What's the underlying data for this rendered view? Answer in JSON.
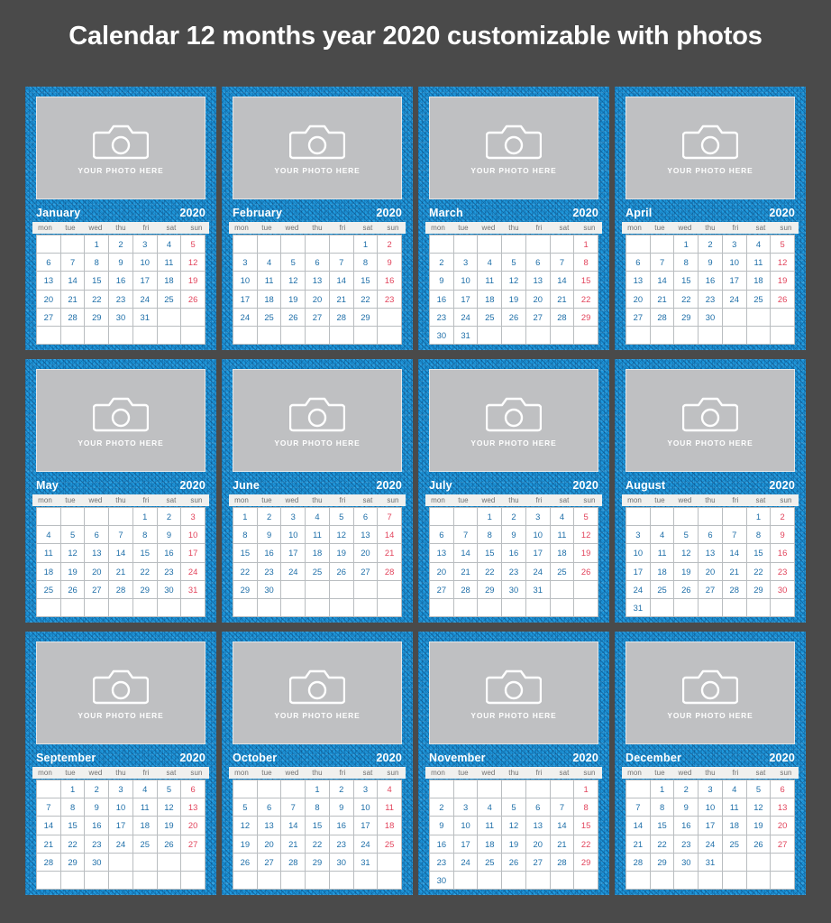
{
  "page": {
    "title": "Calendar 12 months year 2020 customizable with photos",
    "background_color": "#4a4a4a",
    "accent_color": "#1f9ade",
    "weekday_color": "#1d6ea8",
    "sunday_color": "#e2445c"
  },
  "photo_placeholder": {
    "label": "YOUR PHOTO HERE",
    "icon": "camera-icon",
    "background_color": "#bfc0c2"
  },
  "weekdays": [
    "mon",
    "tue",
    "wed",
    "thu",
    "fri",
    "sat",
    "sun"
  ],
  "year": "2020",
  "months": [
    {
      "name": "January",
      "year": "2020",
      "lead_blanks": 2,
      "days": 31,
      "rows": 6,
      "weeks": [
        [
          "",
          "",
          "1",
          "2",
          "3",
          "4",
          "5"
        ],
        [
          "6",
          "7",
          "8",
          "9",
          "10",
          "11",
          "12"
        ],
        [
          "13",
          "14",
          "15",
          "16",
          "17",
          "18",
          "19"
        ],
        [
          "20",
          "21",
          "22",
          "23",
          "24",
          "25",
          "26"
        ],
        [
          "27",
          "28",
          "29",
          "30",
          "31",
          "",
          ""
        ],
        [
          "",
          "",
          "",
          "",
          "",
          "",
          ""
        ]
      ]
    },
    {
      "name": "February",
      "year": "2020",
      "lead_blanks": 5,
      "days": 29,
      "rows": 6,
      "weeks": [
        [
          "",
          "",
          "",
          "",
          "",
          "1",
          "2"
        ],
        [
          "3",
          "4",
          "5",
          "6",
          "7",
          "8",
          "9"
        ],
        [
          "10",
          "11",
          "12",
          "13",
          "14",
          "15",
          "16"
        ],
        [
          "17",
          "18",
          "19",
          "20",
          "21",
          "22",
          "23"
        ],
        [
          "24",
          "25",
          "26",
          "27",
          "28",
          "29",
          ""
        ],
        [
          "",
          "",
          "",
          "",
          "",
          "",
          ""
        ]
      ]
    },
    {
      "name": "March",
      "year": "2020",
      "lead_blanks": 6,
      "days": 31,
      "rows": 6,
      "weeks": [
        [
          "",
          "",
          "",
          "",
          "",
          "",
          "1"
        ],
        [
          "2",
          "3",
          "4",
          "5",
          "6",
          "7",
          "8"
        ],
        [
          "9",
          "10",
          "11",
          "12",
          "13",
          "14",
          "15"
        ],
        [
          "16",
          "17",
          "18",
          "19",
          "20",
          "21",
          "22"
        ],
        [
          "23",
          "24",
          "25",
          "26",
          "27",
          "28",
          "29"
        ],
        [
          "30",
          "31",
          "",
          "",
          "",
          "",
          ""
        ]
      ]
    },
    {
      "name": "April",
      "year": "2020",
      "lead_blanks": 2,
      "days": 30,
      "rows": 6,
      "weeks": [
        [
          "",
          "",
          "1",
          "2",
          "3",
          "4",
          "5"
        ],
        [
          "6",
          "7",
          "8",
          "9",
          "10",
          "11",
          "12"
        ],
        [
          "13",
          "14",
          "15",
          "16",
          "17",
          "18",
          "19"
        ],
        [
          "20",
          "21",
          "22",
          "23",
          "24",
          "25",
          "26"
        ],
        [
          "27",
          "28",
          "29",
          "30",
          "",
          "",
          ""
        ],
        [
          "",
          "",
          "",
          "",
          "",
          "",
          ""
        ]
      ]
    },
    {
      "name": "May",
      "year": "2020",
      "lead_blanks": 4,
      "days": 31,
      "rows": 6,
      "weeks": [
        [
          "",
          "",
          "",
          "",
          "1",
          "2",
          "3"
        ],
        [
          "4",
          "5",
          "6",
          "7",
          "8",
          "9",
          "10"
        ],
        [
          "11",
          "12",
          "13",
          "14",
          "15",
          "16",
          "17"
        ],
        [
          "18",
          "19",
          "20",
          "21",
          "22",
          "23",
          "24"
        ],
        [
          "25",
          "26",
          "27",
          "28",
          "29",
          "30",
          "31"
        ],
        [
          "",
          "",
          "",
          "",
          "",
          "",
          ""
        ]
      ]
    },
    {
      "name": "June",
      "year": "2020",
      "lead_blanks": 0,
      "days": 30,
      "rows": 6,
      "weeks": [
        [
          "1",
          "2",
          "3",
          "4",
          "5",
          "6",
          "7"
        ],
        [
          "8",
          "9",
          "10",
          "11",
          "12",
          "13",
          "14"
        ],
        [
          "15",
          "16",
          "17",
          "18",
          "19",
          "20",
          "21"
        ],
        [
          "22",
          "23",
          "24",
          "25",
          "26",
          "27",
          "28"
        ],
        [
          "29",
          "30",
          "",
          "",
          "",
          "",
          ""
        ],
        [
          "",
          "",
          "",
          "",
          "",
          "",
          ""
        ]
      ]
    },
    {
      "name": "July",
      "year": "2020",
      "lead_blanks": 2,
      "days": 31,
      "rows": 6,
      "weeks": [
        [
          "",
          "",
          "1",
          "2",
          "3",
          "4",
          "5"
        ],
        [
          "6",
          "7",
          "8",
          "9",
          "10",
          "11",
          "12"
        ],
        [
          "13",
          "14",
          "15",
          "16",
          "17",
          "18",
          "19"
        ],
        [
          "20",
          "21",
          "22",
          "23",
          "24",
          "25",
          "26"
        ],
        [
          "27",
          "28",
          "29",
          "30",
          "31",
          "",
          ""
        ],
        [
          "",
          "",
          "",
          "",
          "",
          "",
          ""
        ]
      ]
    },
    {
      "name": "August",
      "year": "2020",
      "lead_blanks": 5,
      "days": 31,
      "rows": 6,
      "weeks": [
        [
          "",
          "",
          "",
          "",
          "",
          "1",
          "2"
        ],
        [
          "3",
          "4",
          "5",
          "6",
          "7",
          "8",
          "9"
        ],
        [
          "10",
          "11",
          "12",
          "13",
          "14",
          "15",
          "16"
        ],
        [
          "17",
          "18",
          "19",
          "20",
          "21",
          "22",
          "23"
        ],
        [
          "24",
          "25",
          "26",
          "27",
          "28",
          "29",
          "30"
        ],
        [
          "31",
          "",
          "",
          "",
          "",
          "",
          ""
        ]
      ]
    },
    {
      "name": "September",
      "year": "2020",
      "lead_blanks": 1,
      "days": 30,
      "rows": 6,
      "weeks": [
        [
          "",
          "1",
          "2",
          "3",
          "4",
          "5",
          "6"
        ],
        [
          "7",
          "8",
          "9",
          "10",
          "11",
          "12",
          "13"
        ],
        [
          "14",
          "15",
          "16",
          "17",
          "18",
          "19",
          "20"
        ],
        [
          "21",
          "22",
          "23",
          "24",
          "25",
          "26",
          "27"
        ],
        [
          "28",
          "29",
          "30",
          "",
          "",
          "",
          ""
        ],
        [
          "",
          "",
          "",
          "",
          "",
          "",
          ""
        ]
      ]
    },
    {
      "name": "October",
      "year": "2020",
      "lead_blanks": 3,
      "days": 31,
      "rows": 6,
      "weeks": [
        [
          "",
          "",
          "",
          "1",
          "2",
          "3",
          "4"
        ],
        [
          "5",
          "6",
          "7",
          "8",
          "9",
          "10",
          "11"
        ],
        [
          "12",
          "13",
          "14",
          "15",
          "16",
          "17",
          "18"
        ],
        [
          "19",
          "20",
          "21",
          "22",
          "23",
          "24",
          "25"
        ],
        [
          "26",
          "27",
          "28",
          "29",
          "30",
          "31",
          ""
        ],
        [
          "",
          "",
          "",
          "",
          "",
          "",
          ""
        ]
      ]
    },
    {
      "name": "November",
      "year": "2020",
      "lead_blanks": 6,
      "days": 30,
      "rows": 6,
      "weeks": [
        [
          "",
          "",
          "",
          "",
          "",
          "",
          "1"
        ],
        [
          "2",
          "3",
          "4",
          "5",
          "6",
          "7",
          "8"
        ],
        [
          "9",
          "10",
          "11",
          "12",
          "13",
          "14",
          "15"
        ],
        [
          "16",
          "17",
          "18",
          "19",
          "20",
          "21",
          "22"
        ],
        [
          "23",
          "24",
          "25",
          "26",
          "27",
          "28",
          "29"
        ],
        [
          "30",
          "",
          "",
          "",
          "",
          "",
          ""
        ]
      ]
    },
    {
      "name": "December",
      "year": "2020",
      "lead_blanks": 1,
      "days": 31,
      "rows": 6,
      "weeks": [
        [
          "",
          "1",
          "2",
          "3",
          "4",
          "5",
          "6"
        ],
        [
          "7",
          "8",
          "9",
          "10",
          "11",
          "12",
          "13"
        ],
        [
          "14",
          "15",
          "16",
          "17",
          "18",
          "19",
          "20"
        ],
        [
          "21",
          "22",
          "23",
          "24",
          "25",
          "26",
          "27"
        ],
        [
          "28",
          "29",
          "30",
          "31",
          "",
          "",
          ""
        ],
        [
          "",
          "",
          "",
          "",
          "",
          "",
          ""
        ]
      ]
    }
  ]
}
